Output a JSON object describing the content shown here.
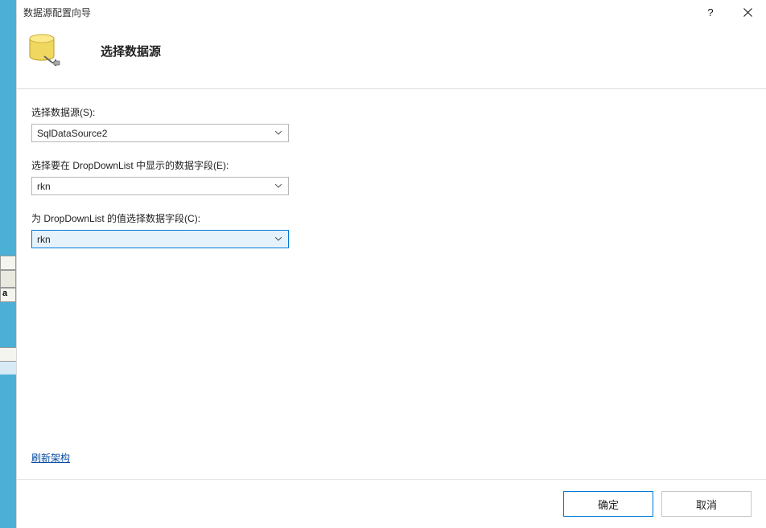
{
  "window": {
    "title": "数据源配置向导",
    "help": "?",
    "close": "×"
  },
  "header": {
    "title": "选择数据源"
  },
  "fields": {
    "datasource_label": "选择数据源(S):",
    "datasource_value": "SqlDataSource2",
    "displayfield_label": "选择要在 DropDownList 中显示的数据字段(E):",
    "displayfield_value": "rkn",
    "valuefield_label": "为 DropDownList 的值选择数据字段(C):",
    "valuefield_value": "rkn"
  },
  "links": {
    "refresh_schema": "刷新架构"
  },
  "buttons": {
    "ok": "确定",
    "cancel": "取消"
  },
  "backdrop": {
    "stripe3_text": "a"
  }
}
